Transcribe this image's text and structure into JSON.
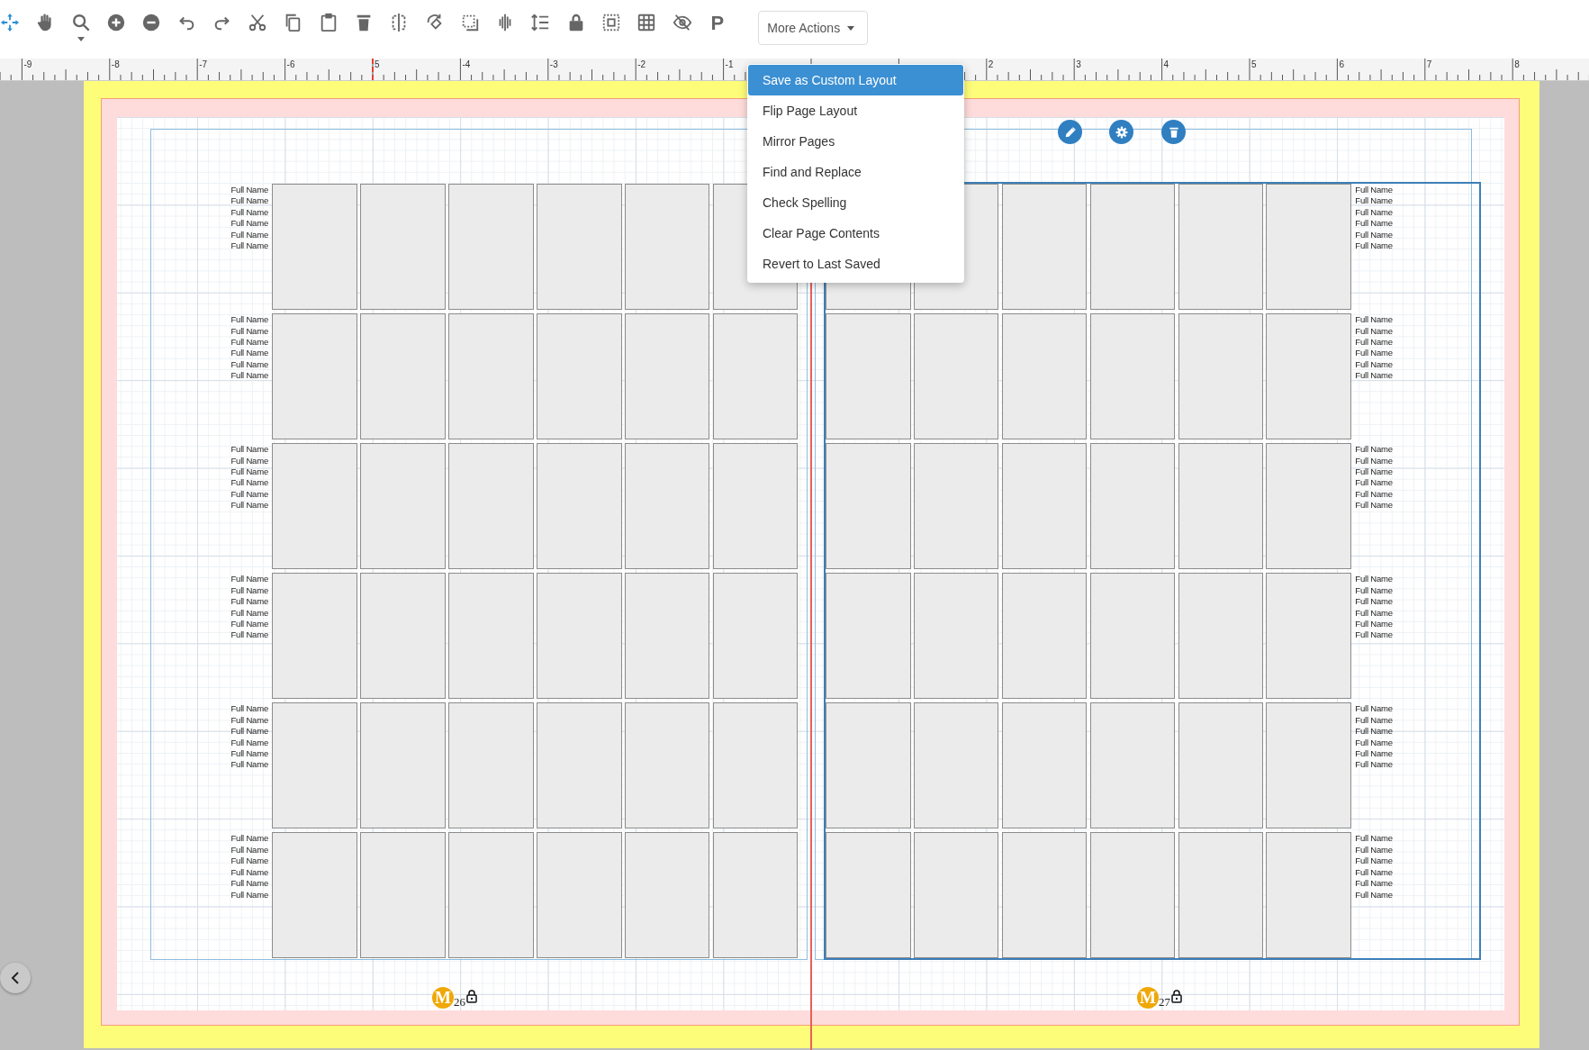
{
  "toolbar": {
    "text_tool": "P",
    "more_actions": "More Actions"
  },
  "ruler": {
    "ticks": [
      {
        "label": "-9",
        "marked": false
      },
      {
        "label": "-8",
        "marked": false
      },
      {
        "label": "-7",
        "marked": false
      },
      {
        "label": "-6",
        "marked": false
      },
      {
        "label": "5",
        "marked": true
      },
      {
        "label": "-4",
        "marked": false
      },
      {
        "label": "-3",
        "marked": false
      },
      {
        "label": "-2",
        "marked": false
      },
      {
        "label": "-1",
        "marked": false
      },
      {
        "label": "2",
        "marked": false
      },
      {
        "label": "3",
        "marked": false
      },
      {
        "label": "4",
        "marked": false
      },
      {
        "label": "5",
        "marked": false
      },
      {
        "label": "6",
        "marked": false
      },
      {
        "label": "7",
        "marked": false
      },
      {
        "label": "8",
        "marked": false
      }
    ]
  },
  "menu": {
    "items": [
      {
        "label": "Save as Custom Layout",
        "selected": true
      },
      {
        "label": "Flip Page Layout",
        "selected": false
      },
      {
        "label": "Mirror Pages",
        "selected": false
      },
      {
        "label": "Find and Replace",
        "selected": false
      },
      {
        "label": "Check Spelling",
        "selected": false
      },
      {
        "label": "Clear Page Contents",
        "selected": false
      },
      {
        "label": "Revert to Last Saved",
        "selected": false
      }
    ]
  },
  "pages": [
    {
      "page_number": "26",
      "master_badge": "M",
      "selected": false,
      "rows": [
        {
          "names": [
            "Full Name",
            "Full Name",
            "Full Name",
            "Full Name",
            "Full Name",
            "Full Name"
          ]
        },
        {
          "names": [
            "Full Name",
            "Full Name",
            "Full Name",
            "Full Name",
            "Full Name",
            "Full Name"
          ]
        },
        {
          "names": [
            "Full Name",
            "Full Name",
            "Full Name",
            "Full Name",
            "Full Name",
            "Full Name"
          ]
        },
        {
          "names": [
            "Full Name",
            "Full Name",
            "Full Name",
            "Full Name",
            "Full Name",
            "Full Name"
          ]
        },
        {
          "names": [
            "Full Name",
            "Full Name",
            "Full Name",
            "Full Name",
            "Full Name",
            "Full Name"
          ]
        },
        {
          "names": [
            "Full Name",
            "Full Name",
            "Full Name",
            "Full Name",
            "Full Name",
            "Full Name"
          ]
        }
      ]
    },
    {
      "page_number": "27",
      "master_badge": "M",
      "selected": true,
      "rows": [
        {
          "names": [
            "Full Name",
            "Full Name",
            "Full Name",
            "Full Name",
            "Full Name",
            "Full Name"
          ]
        },
        {
          "names": [
            "Full Name",
            "Full Name",
            "Full Name",
            "Full Name",
            "Full Name",
            "Full Name"
          ]
        },
        {
          "names": [
            "Full Name",
            "Full Name",
            "Full Name",
            "Full Name",
            "Full Name",
            "Full Name"
          ]
        },
        {
          "names": [
            "Full Name",
            "Full Name",
            "Full Name",
            "Full Name",
            "Full Name",
            "Full Name"
          ]
        },
        {
          "names": [
            "Full Name",
            "Full Name",
            "Full Name",
            "Full Name",
            "Full Name",
            "Full Name"
          ]
        },
        {
          "names": [
            "Full Name",
            "Full Name",
            "Full Name",
            "Full Name",
            "Full Name",
            "Full Name"
          ]
        }
      ]
    }
  ]
}
